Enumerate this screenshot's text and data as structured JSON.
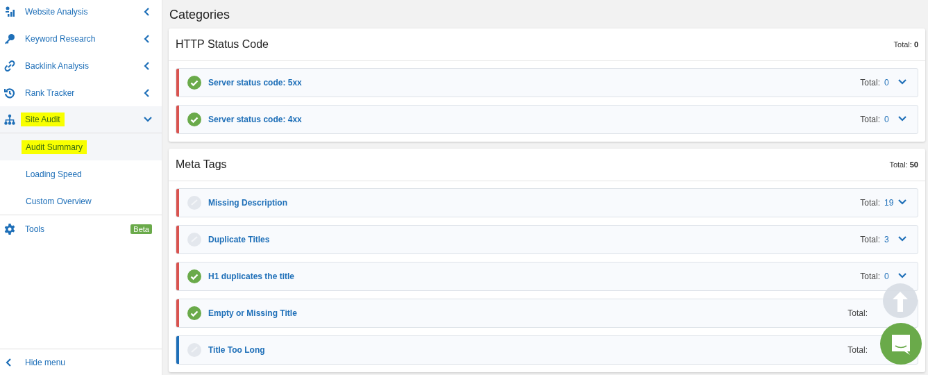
{
  "sidebar": {
    "items": [
      {
        "label": "Website Analysis",
        "expanded": false,
        "highlighted": false
      },
      {
        "label": "Keyword Research",
        "expanded": false,
        "highlighted": false
      },
      {
        "label": "Backlink Analysis",
        "expanded": false,
        "highlighted": false
      },
      {
        "label": "Rank Tracker",
        "expanded": false,
        "highlighted": false
      },
      {
        "label": "Site Audit",
        "expanded": true,
        "highlighted": true,
        "children": [
          {
            "label": "Audit Summary",
            "selected": true,
            "highlighted": true
          },
          {
            "label": "Loading Speed",
            "selected": false,
            "highlighted": false
          },
          {
            "label": "Custom Overview",
            "selected": false,
            "highlighted": false
          }
        ]
      },
      {
        "label": "Tools",
        "badge": "Beta"
      }
    ],
    "footer": "Hide menu"
  },
  "main": {
    "title": "Categories",
    "sections": [
      {
        "title": "HTTP Status Code",
        "total_label": "Total:",
        "total": "0",
        "rows": [
          {
            "label": "Server status code: 5xx",
            "passed": true,
            "color": "#d9534f",
            "total_label": "Total:",
            "total": "0"
          },
          {
            "label": "Server status code: 4xx",
            "passed": true,
            "color": "#d9534f",
            "total_label": "Total:",
            "total": "0"
          }
        ]
      },
      {
        "title": "Meta Tags",
        "total_label": "Total:",
        "total": "50",
        "rows": [
          {
            "label": "Missing Description",
            "passed": false,
            "color": "#d9534f",
            "total_label": "Total:",
            "total": "19"
          },
          {
            "label": "Duplicate Titles",
            "passed": false,
            "color": "#d9534f",
            "total_label": "Total:",
            "total": "3"
          },
          {
            "label": "H1 duplicates the title",
            "passed": true,
            "color": "#d9534f",
            "total_label": "Total:",
            "total": "0"
          },
          {
            "label": "Empty or Missing Title",
            "passed": true,
            "color": "#d9534f",
            "total_label": "Total:"
          },
          {
            "label": "Title Too Long",
            "passed": false,
            "color": "#1e6fb8",
            "total_label": "Total:"
          }
        ]
      }
    ]
  }
}
